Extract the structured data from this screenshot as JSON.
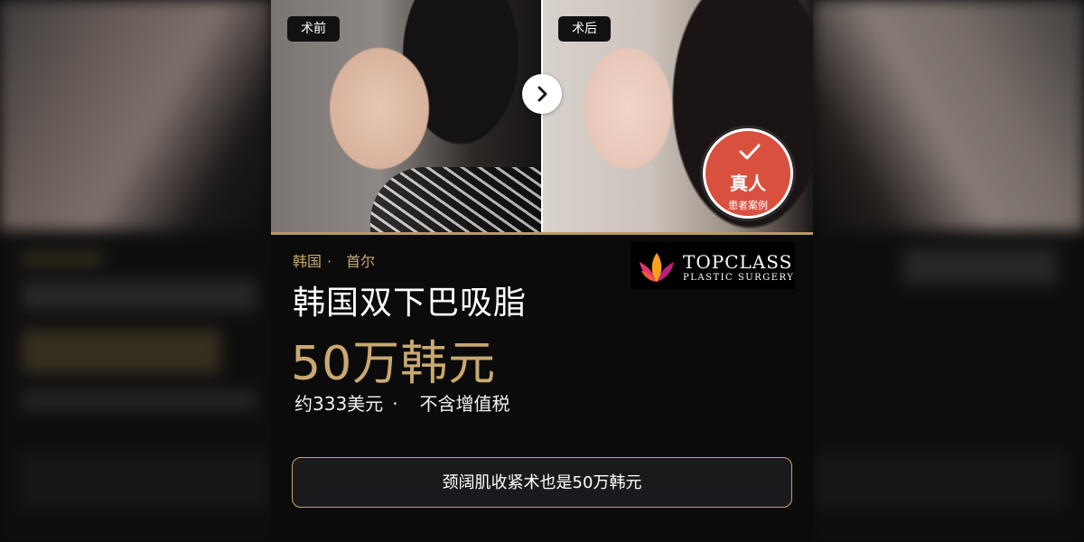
{
  "tags": {
    "before": "术前",
    "after": "术后"
  },
  "badge": {
    "main": "真人",
    "sub": "患者案例"
  },
  "location": {
    "country": "韩国",
    "separator": "·",
    "city": "首尔"
  },
  "title": "韩国双下巴吸脂",
  "price": "50万韩元",
  "subline": {
    "usd": "约333美元",
    "separator": "·",
    "tax": "不含增值税"
  },
  "logo": {
    "name": "TOPCLASS",
    "sub": "PLASTIC SURGERY"
  },
  "cta": "颈阔肌收紧术也是50万韩元",
  "colors": {
    "gold": "#c9a86a",
    "badge_red": "#d9503f",
    "background": "#0b0b0c"
  }
}
